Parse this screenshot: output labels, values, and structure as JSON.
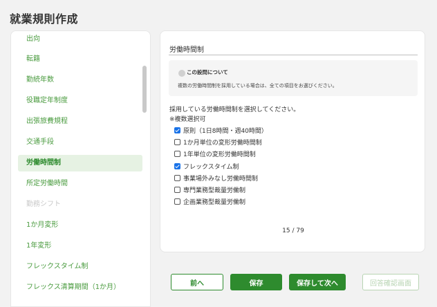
{
  "page": {
    "title": "就業規則作成"
  },
  "sidebar": {
    "items": [
      {
        "label": "出向",
        "state": "normal"
      },
      {
        "label": "転籍",
        "state": "normal"
      },
      {
        "label": "勤続年数",
        "state": "normal"
      },
      {
        "label": "役職定年制度",
        "state": "normal"
      },
      {
        "label": "出張旅費規程",
        "state": "normal"
      },
      {
        "label": "交通手段",
        "state": "normal"
      },
      {
        "label": "労働時間制",
        "state": "active"
      },
      {
        "label": "所定労働時間",
        "state": "normal"
      },
      {
        "label": "勤務シフト",
        "state": "disabled"
      },
      {
        "label": "1か月変形",
        "state": "normal"
      },
      {
        "label": "1年変形",
        "state": "normal"
      },
      {
        "label": "フレックスタイム制",
        "state": "normal"
      },
      {
        "label": "フレックス清算期間（1か月）",
        "state": "normal"
      }
    ]
  },
  "main": {
    "section_title": "労働時間制",
    "info": {
      "title": "この設問について",
      "text": "複数の労働時間制を採用している場合は、全ての項目をお選びください。"
    },
    "question": "採用している労働時間制を選択してください。",
    "note": "※複数選択可",
    "options": [
      {
        "label": "原則（1日8時間・週40時間）",
        "checked": true
      },
      {
        "label": "1か月単位の変形労働時間制",
        "checked": false
      },
      {
        "label": "1年単位の変形労働時間制",
        "checked": false
      },
      {
        "label": "フレックスタイム制",
        "checked": true
      },
      {
        "label": "事業場外みなし労働時間制",
        "checked": false
      },
      {
        "label": "専門業務型裁量労働制",
        "checked": false
      },
      {
        "label": "企画業務型裁量労働制",
        "checked": false
      }
    ],
    "pagination": "15 / 79"
  },
  "buttons": {
    "prev": "前へ",
    "save": "保存",
    "save_next": "保存して次へ",
    "review": "回答確認画面"
  }
}
